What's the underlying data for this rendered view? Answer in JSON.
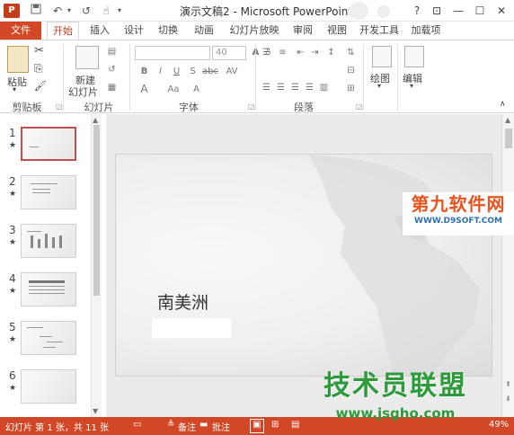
{
  "titlebar": {
    "title": "演示文稿2 - Microsoft PowerPoint",
    "app_icon": "P",
    "quick_access": {
      "save_icon": "💾",
      "undo_icon": "↶",
      "redo_icon": "↺",
      "touch_icon": "☝"
    },
    "window_controls": {
      "help": "?",
      "ribbon_display": "⊡",
      "minimize": "—",
      "maximize": "☐",
      "close": "✕"
    }
  },
  "tabs": {
    "file": "文件",
    "items": [
      "开始",
      "插入",
      "设计",
      "切换",
      "动画",
      "幻灯片放映",
      "审阅",
      "视图",
      "开发工具",
      "加载项"
    ],
    "active": "开始"
  },
  "ribbon": {
    "clipboard": {
      "group": "剪贴板",
      "paste": "粘贴",
      "cut_icon": "✂",
      "copy_icon": "⎘",
      "format_painter_icon": "🖌"
    },
    "slides": {
      "group": "幻灯片",
      "new_slide_line1": "新建",
      "new_slide_line2": "幻灯片"
    },
    "font": {
      "group": "字体",
      "font_size": "40",
      "bold": "B",
      "italic": "I",
      "underline": "U",
      "strike": "S",
      "shadow": "abc",
      "spacing": "AV",
      "grow": "A",
      "shrink": "A",
      "case": "Aa",
      "clear": "A",
      "color": "A"
    },
    "paragraph": {
      "group": "段落"
    },
    "drawing": {
      "label": "绘图"
    },
    "editing": {
      "label": "编辑"
    }
  },
  "thumbnails": [
    {
      "num": "1",
      "star": "★"
    },
    {
      "num": "2",
      "star": "★"
    },
    {
      "num": "3",
      "star": "★"
    },
    {
      "num": "4",
      "star": "★"
    },
    {
      "num": "5",
      "star": "★"
    },
    {
      "num": "6",
      "star": "★"
    }
  ],
  "slide": {
    "title": "南美洲"
  },
  "watermarks": {
    "top_main": "第九软件网",
    "top_sub": "WWW.D9SOFT.COM",
    "bottom_main": "技术员联盟",
    "bottom_sub": "www.jsgho.com"
  },
  "statusbar": {
    "slide_info": "幻灯片 第 1 张，共 11 张",
    "notes": "备注",
    "comments": "批注",
    "zoom": "49%"
  }
}
